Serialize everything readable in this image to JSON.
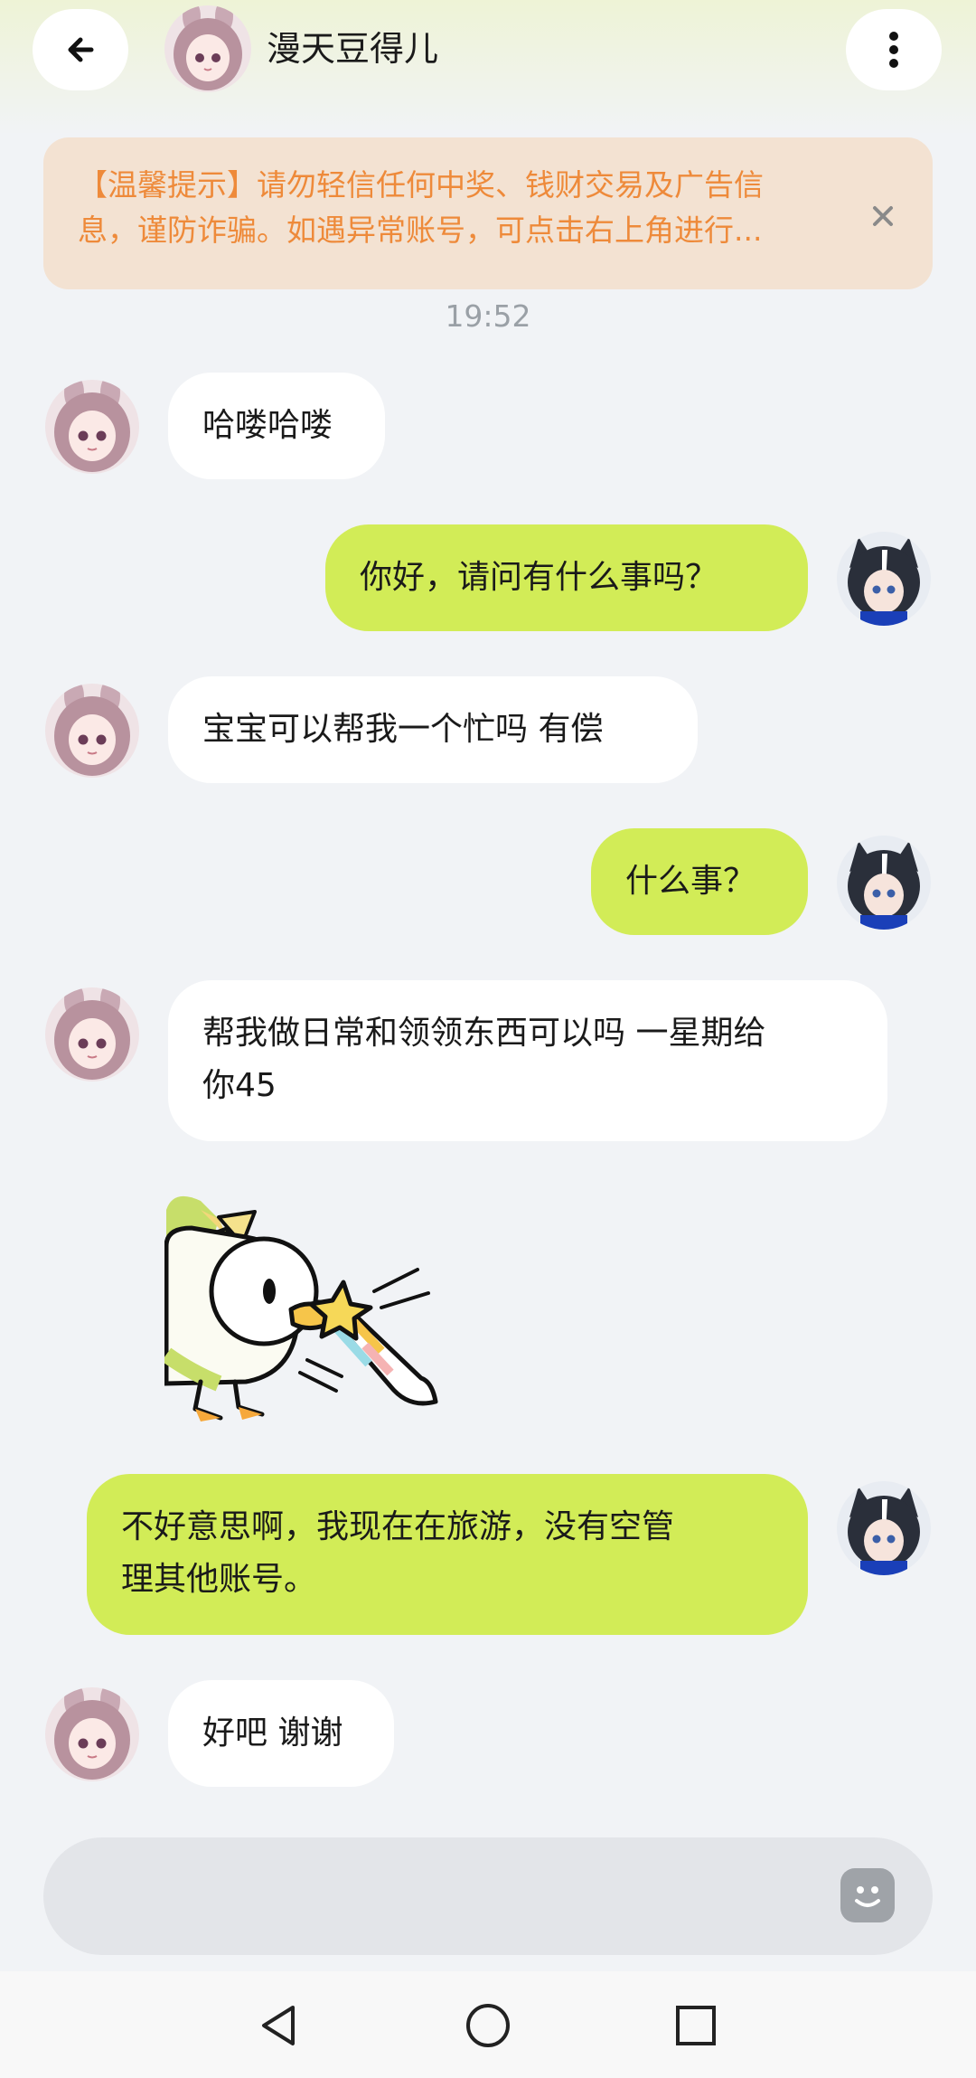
{
  "header": {
    "title": "漫天豆得儿",
    "back_icon": "arrow-left-icon",
    "more_icon": "more-vertical-icon"
  },
  "notice": {
    "line1": "【温馨提示】请勿轻信任何中奖、钱财交易及广告信",
    "line2": "息，谨防诈骗。如遇异常账号，可点击右上角进行...",
    "close_icon": "close-icon",
    "text_color": "#ee8a3a",
    "background": "#f3e2d2"
  },
  "timestamp": "19:52",
  "messages": [
    {
      "side": "in",
      "lines": [
        "哈喽哈喽"
      ]
    },
    {
      "side": "out",
      "lines": [
        "你好，请问有什么事吗？"
      ]
    },
    {
      "side": "in",
      "lines": [
        "宝宝可以帮我一个忙吗 有偿"
      ]
    },
    {
      "side": "out",
      "lines": [
        "什么事？"
      ]
    },
    {
      "side": "in",
      "lines": [
        "帮我做日常和领领东西可以吗 一星期给",
        "你45"
      ]
    },
    {
      "side": "in",
      "type": "sticker",
      "icon": "duck-party-horn-sticker"
    },
    {
      "side": "out",
      "lines": [
        "不好意思啊，我现在在旅游，没有空管",
        "理其他账号。"
      ]
    },
    {
      "side": "in",
      "lines": [
        "好吧 谢谢"
      ]
    }
  ],
  "input": {
    "placeholder": "",
    "emoji_icon": "emoji-icon"
  },
  "nav": {
    "back_icon": "nav-back-icon",
    "home_icon": "nav-home-icon",
    "recents_icon": "nav-recents-icon"
  },
  "colors": {
    "outgoing_bubble": "#d2ec57",
    "incoming_bubble": "#ffffff",
    "background": "#f1f3f6"
  }
}
